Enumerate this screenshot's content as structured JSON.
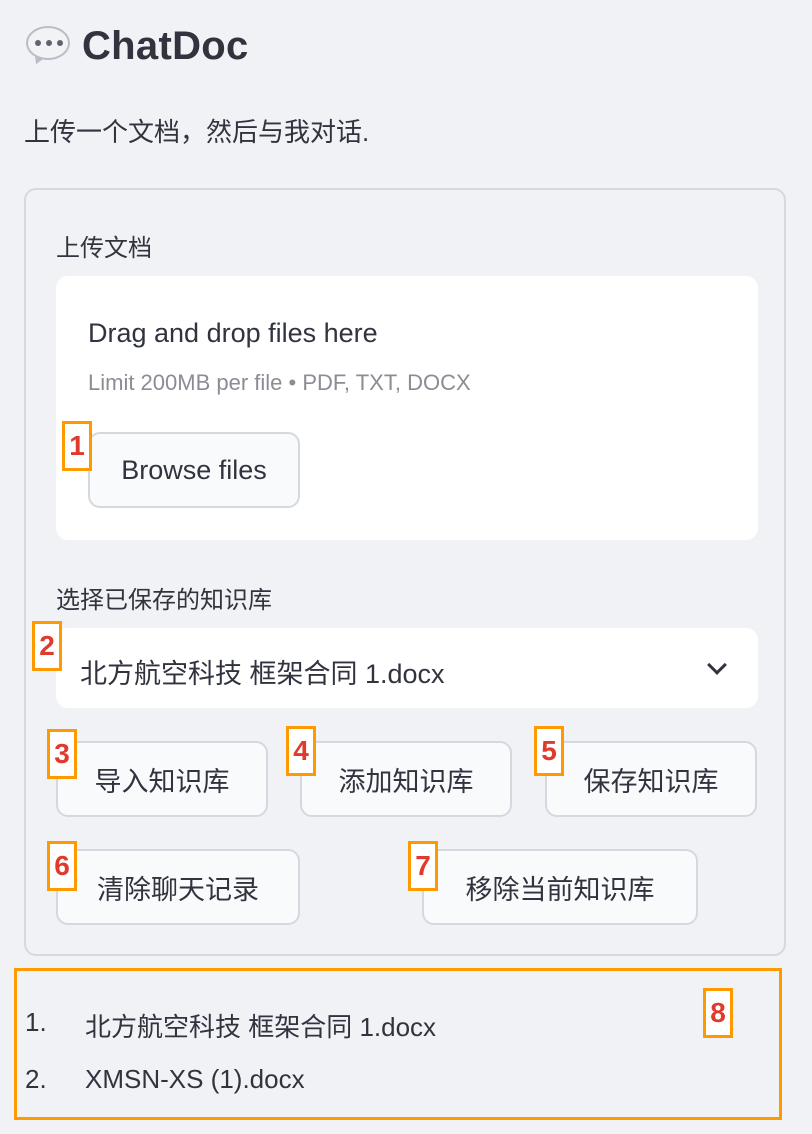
{
  "app": {
    "title": "ChatDoc",
    "title_icon": "speech-bubble-icon",
    "subtitle": "上传一个文档，然后与我对话."
  },
  "upload": {
    "label": "上传文档",
    "drop_text": "Drag and drop files here",
    "limit_text": "Limit 200MB per file • PDF, TXT, DOCX",
    "browse_label": "Browse files"
  },
  "kb_select": {
    "label": "选择已保存的知识库",
    "selected": "北方航空科技 框架合同 1.docx"
  },
  "actions": {
    "import_label": "导入知识库",
    "add_label": "添加知识库",
    "save_label": "保存知识库",
    "clear_label": "清除聊天记录",
    "remove_label": "移除当前知识库"
  },
  "files": [
    {
      "num": "1.",
      "name": "北方航空科技 框架合同 1.docx"
    },
    {
      "num": "2.",
      "name": "XMSN-XS (1).docx"
    }
  ],
  "badges": [
    "1",
    "2",
    "3",
    "4",
    "5",
    "6",
    "7",
    "8"
  ],
  "colors": {
    "background": "#f0f2f6",
    "badge_border": "#ff9900",
    "badge_text": "#e03a2c",
    "text": "#31333f"
  }
}
